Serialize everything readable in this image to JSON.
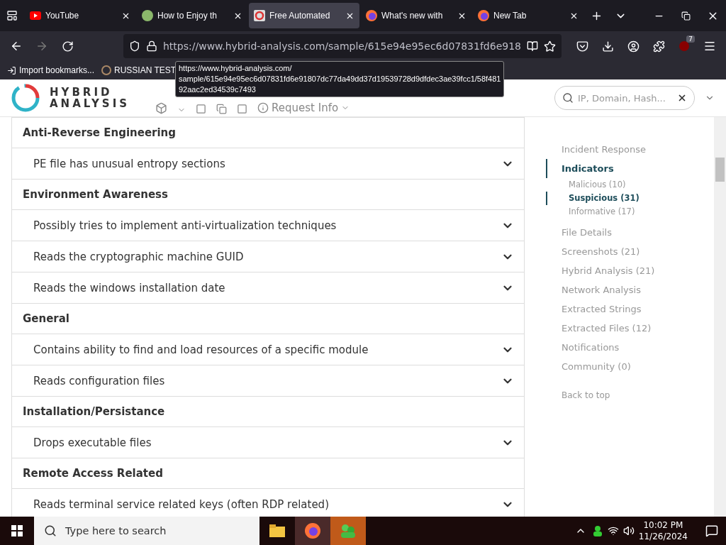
{
  "browser_tabs": [
    {
      "label": "YouTube",
      "selected": false,
      "kind": "youtube"
    },
    {
      "label": "How to Enjoy th",
      "selected": false,
      "kind": "green"
    },
    {
      "label": "Free Automated",
      "selected": true,
      "kind": "ha"
    },
    {
      "label": "What's new with",
      "selected": false,
      "kind": "firefox"
    },
    {
      "label": "New Tab",
      "selected": false,
      "kind": "firefox"
    }
  ],
  "address_bar": {
    "value": "https://www.hybrid-analysis.com/sample/615e94e95ec6d07831fd6e918"
  },
  "extension_badge": "7",
  "bookmarks": [
    "Import bookmarks...",
    "RUSSIAN TEST"
  ],
  "link_tooltip": "https://www.hybrid-analysis.com/\nsample/615e94e95ec6d07831fd6e91807dc77da49dd37d19539728d9dfdec3ae39fcc1/58f481\n92aac2ed34539c7493",
  "site_header": {
    "logo_top": "HYBRID",
    "logo_bottom": "ANALYSIS",
    "nav_link": "Request Info",
    "search_placeholder": "IP, Domain, Hash..."
  },
  "indicator_groups": [
    {
      "title": "Anti-Reverse Engineering",
      "items": [
        "PE file has unusual entropy sections"
      ]
    },
    {
      "title": "Environment Awareness",
      "items": [
        "Possibly tries to implement anti-virtualization techniques",
        "Reads the cryptographic machine GUID",
        "Reads the windows installation date"
      ]
    },
    {
      "title": "General",
      "items": [
        "Contains ability to find and load resources of a specific module",
        "Reads configuration files"
      ]
    },
    {
      "title": "Installation/Persistance",
      "items": [
        "Drops executable files"
      ]
    },
    {
      "title": "Remote Access Related",
      "items": [
        "Reads terminal service related keys (often RDP related)"
      ]
    }
  ],
  "side_nav": [
    {
      "label": "Incident Response",
      "selected": false
    },
    {
      "label": "Indicators",
      "selected": true,
      "children": [
        {
          "label": "Malicious (10)",
          "selected": false
        },
        {
          "label": "Suspicious (31)",
          "selected": true
        },
        {
          "label": "Informative (17)",
          "selected": false
        }
      ]
    },
    {
      "label": "File Details",
      "selected": false
    },
    {
      "label": "Screenshots (21)",
      "selected": false
    },
    {
      "label": "Hybrid Analysis (21)",
      "selected": false
    },
    {
      "label": "Network Analysis",
      "selected": false
    },
    {
      "label": "Extracted Strings",
      "selected": false
    },
    {
      "label": "Extracted Files (12)",
      "selected": false
    },
    {
      "label": "Notifications",
      "selected": false
    },
    {
      "label": "Community (0)",
      "selected": false
    }
  ],
  "back_to_top": "Back to top",
  "taskbar": {
    "search_placeholder": "Type here to search",
    "time": "10:02 PM",
    "date": "11/26/2024"
  }
}
